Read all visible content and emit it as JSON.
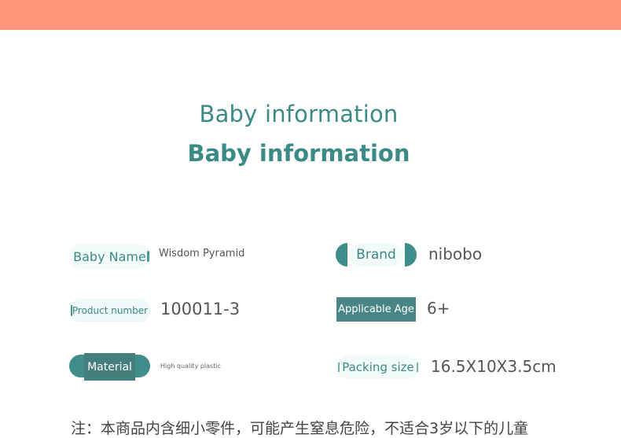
{
  "header": {
    "bar_color": "#ff967b"
  },
  "titles": {
    "line1": "Baby information",
    "line2": "Baby information"
  },
  "specs": {
    "baby_name": {
      "label": "Baby Name",
      "value": "Wisdom Pyramid"
    },
    "brand": {
      "label": "Brand",
      "value": "nibobo"
    },
    "product_number": {
      "label": "Product number",
      "value": "100011-3"
    },
    "applicable_age": {
      "label": "Applicable Age",
      "value": "6+"
    },
    "material": {
      "label": "Material",
      "value": "High quality plastic"
    },
    "packing_size": {
      "label": "Packing size",
      "value": "16.5X10X3.5cm"
    }
  },
  "note": "注：本商品内含细小零件，可能产生窒息危险，不适合3岁以下的儿童",
  "colors": {
    "accent": "#3a8a86",
    "dark_accent": "#447f7d"
  }
}
